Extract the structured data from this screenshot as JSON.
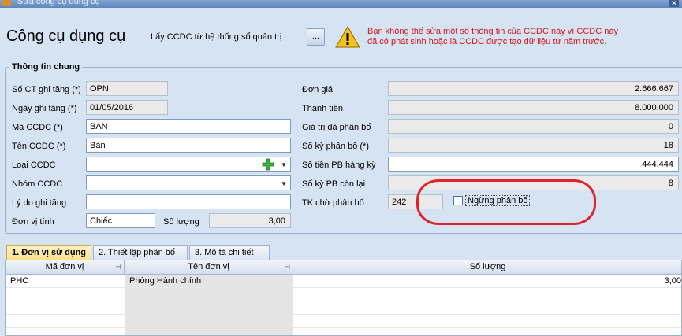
{
  "window": {
    "title": "Sửa công cụ dụng cụ",
    "close": "✕"
  },
  "header": {
    "title": "Công cụ dụng cụ",
    "subtitle": "Lấy CCDC từ hệ thống sổ quản trị",
    "browse_label": "...",
    "warning": "Bạn không thể sửa một số thông tin của CCDC này vì CCDC này đã có phát sinh hoặc là CCDC được tạo dữ liệu từ năm trước."
  },
  "general": {
    "title": "Thông tin chung",
    "so_ct": {
      "label": "Số CT ghi tăng (*)",
      "value": "OPN"
    },
    "ngay": {
      "label": "Ngày ghi tăng (*)",
      "value": "01/05/2016"
    },
    "ma": {
      "label": "Mã CCDC (*)",
      "value": "BAN"
    },
    "ten": {
      "label": "Tên CCDC (*)",
      "value": "Bàn"
    },
    "loai": {
      "label": "Loại CCDC",
      "value": ""
    },
    "nhom": {
      "label": "Nhóm CCDC",
      "value": ""
    },
    "lydo": {
      "label": "Lý do ghi tăng",
      "value": ""
    },
    "dvt": {
      "label": "Đơn vị tính",
      "value": "Chiếc"
    },
    "soluong": {
      "label": "Số lượng",
      "value": "3,00"
    },
    "dongia": {
      "label": "Đơn giá",
      "value": "2.666.667"
    },
    "thanhtien": {
      "label": "Thành tiền",
      "value": "8.000.000"
    },
    "gtdapb": {
      "label": "Giá trị đã phân bổ",
      "value": "0"
    },
    "sokypb": {
      "label": "Số kỳ phân bổ (*)",
      "value": "18"
    },
    "sotienpb": {
      "label": "Số tiền PB hàng kỳ",
      "value": "444.444"
    },
    "sokyconlai": {
      "label": "Số kỳ PB còn lại",
      "value": "8"
    },
    "tkcho": {
      "label": "TK chờ phân bổ",
      "value": "242"
    },
    "ngung": {
      "label": "Ngừng phân bổ",
      "checked": false
    }
  },
  "tabs": [
    {
      "key": "1",
      "label": "1. Đơn vị sử dụng"
    },
    {
      "key": "2",
      "label": "2. Thiết lập phân bổ"
    },
    {
      "key": "3",
      "label": "3. Mô tả chi tiết"
    }
  ],
  "grid": {
    "columns": [
      "Mã đơn vị",
      "Tên đơn vị",
      "Số lượng"
    ],
    "rows": [
      {
        "ma": "PHC",
        "ten": "Phòng Hành chính",
        "sl": "3,00"
      }
    ]
  },
  "colors": {
    "background": "#d5e3f3",
    "warning": "#d01818",
    "highlight": "#e0232a",
    "active_tab": "#fde08a"
  },
  "icons": {
    "warning": "warning-triangle-icon",
    "add": "plus-icon",
    "dropdown": "chevron-down-icon",
    "pin": "pin-icon"
  }
}
